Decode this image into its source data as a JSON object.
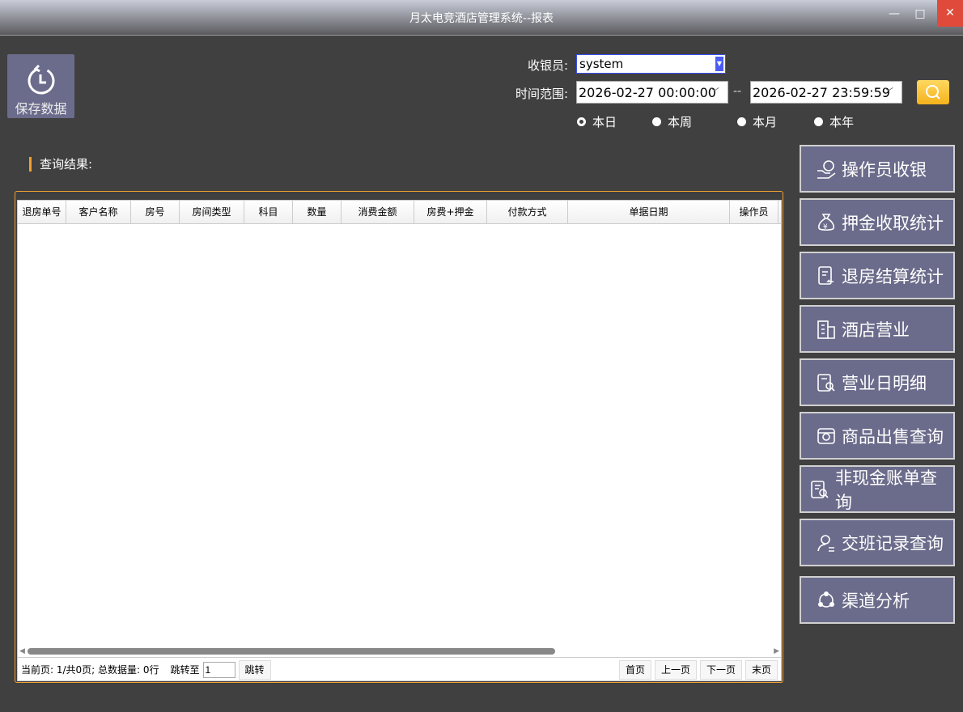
{
  "window": {
    "title": "月太电竞酒店管理系统--报表",
    "minimize": "—",
    "maximize": "□",
    "close": "✕"
  },
  "toolbar": {
    "save_label": "保存数据"
  },
  "filters": {
    "cashier_label": "收银员:",
    "cashier_value": "system",
    "time_label": "时间范围:",
    "start": "2026-02-27 00:00:00",
    "end": "2026-02-27 23:59:59",
    "separator": "--",
    "ranges": [
      {
        "label": "本日",
        "selected": true
      },
      {
        "label": "本周",
        "selected": false
      },
      {
        "label": "本月",
        "selected": false
      },
      {
        "label": "本年",
        "selected": false
      }
    ]
  },
  "results": {
    "heading": "查询结果:",
    "columns": [
      "退房单号",
      "客户名称",
      "房号",
      "房间类型",
      "科目",
      "数量",
      "消费金额",
      "房费+押金",
      "付款方式",
      "单据日期",
      "操作员"
    ],
    "footer": {
      "status": "当前页: 1/共0页; 总数据量: 0行",
      "jump_label": "跳转至",
      "jump_value": "1",
      "jump_button": "跳转",
      "first": "首页",
      "prev": "上一页",
      "next": "下一页",
      "last": "末页"
    }
  },
  "reports": [
    {
      "label": "操作员收银",
      "icon": "hand-coin-icon"
    },
    {
      "label": "押金收取统计",
      "icon": "money-bag-icon"
    },
    {
      "label": "退房结算统计",
      "icon": "return-doc-icon"
    },
    {
      "label": "酒店营业",
      "icon": "building-icon"
    },
    {
      "label": "营业日明细",
      "icon": "detail-search-icon"
    },
    {
      "label": "商品出售查询",
      "icon": "shop-icon"
    },
    {
      "label": "非现金账单查询",
      "icon": "bill-search-icon"
    },
    {
      "label": "交班记录查询",
      "icon": "user-shift-icon"
    },
    {
      "label": "渠道分析",
      "icon": "channel-icon"
    }
  ]
}
